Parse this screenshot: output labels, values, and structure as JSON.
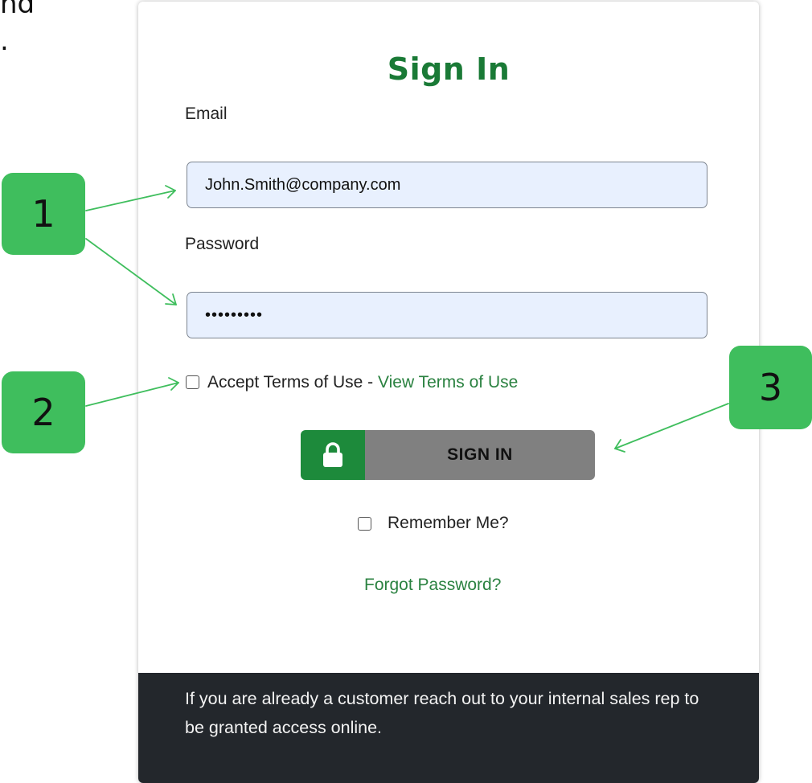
{
  "background_fragment": "nd\n.",
  "card": {
    "title": "Sign In",
    "email": {
      "label": "Email",
      "value": "John.Smith@company.com"
    },
    "password": {
      "label": "Password",
      "value": "•••••••••"
    },
    "terms": {
      "text": "Accept Terms of Use - ",
      "link": "View Terms of Use"
    },
    "sign_in_button": {
      "label": "SIGN IN",
      "icon": "lock-icon"
    },
    "remember_me": "Remember Me?",
    "forgot_password": "Forgot Password?",
    "footer_text": "If you are already a customer reach out to your internal sales rep to be granted access online."
  },
  "callouts": [
    "1",
    "2",
    "3"
  ],
  "colors": {
    "brand_green": "#1a7a36",
    "callout_green": "#3fbe5d",
    "button_gray": "#808080",
    "footer_dark": "#23272c",
    "input_fill": "#e8f0fe"
  }
}
